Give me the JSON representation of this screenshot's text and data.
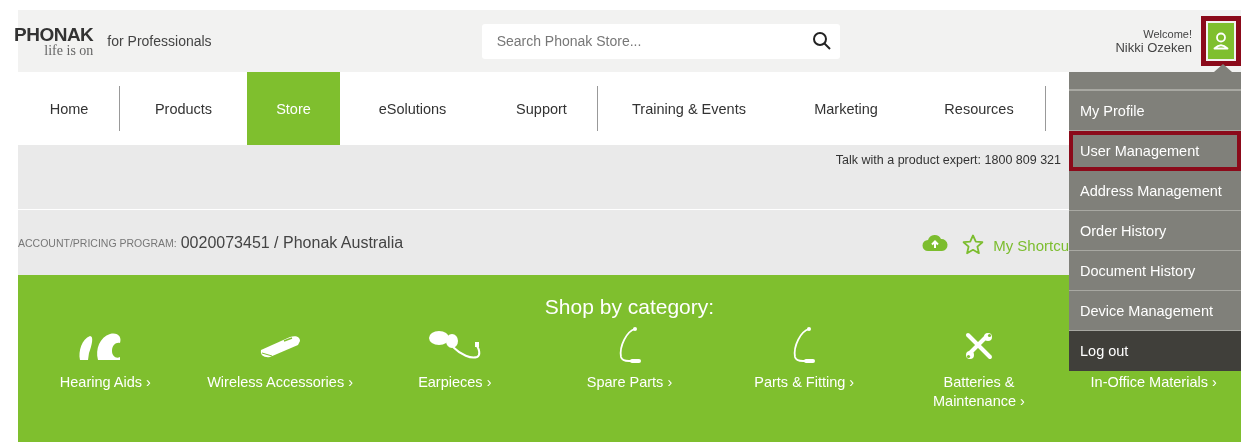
{
  "header": {
    "brand": "PHONAK",
    "tagline": "life is on",
    "subtitle": "for Professionals",
    "search": {
      "placeholder": "Search Phonak Store..."
    },
    "welcome": "Welcome!",
    "user_name": "Nikki Ozeken",
    "user_button": {
      "highlighted": true
    }
  },
  "nav": [
    {
      "label": "Home",
      "selected": false,
      "divider": true
    },
    {
      "label": "Products",
      "selected": false,
      "divider": false
    },
    {
      "label": "Store",
      "selected": true,
      "divider": false
    },
    {
      "label": "eSolutions",
      "selected": false,
      "divider": false
    },
    {
      "label": "Support",
      "selected": false,
      "divider": true
    },
    {
      "label": "Training & Events",
      "selected": false,
      "divider": false
    },
    {
      "label": "Marketing",
      "selected": false,
      "divider": false
    },
    {
      "label": "Resources",
      "selected": false,
      "divider": true
    }
  ],
  "contact": "Talk with a product expert: 1800 809 321",
  "account": {
    "label": "ACCOUNT/PRICING PROGRAM:",
    "value": "0020073451 / Phonak Australia",
    "shortcuts": "My Shortcu"
  },
  "category_section": {
    "title": "Shop by category:",
    "categories": [
      {
        "label": "Hearing Aids ›"
      },
      {
        "label": "Wireless Accessories ›"
      },
      {
        "label": "Earpieces ›"
      },
      {
        "label": "Spare Parts ›"
      },
      {
        "label": "Parts & Fitting ›"
      },
      {
        "label": "Batteries &",
        "label_2": "Maintenance ›"
      },
      {
        "label": "In-Office Materials ›"
      }
    ]
  },
  "user_menu": [
    {
      "label": "My Profile",
      "kind": "link",
      "highlighted": false
    },
    {
      "label": "User Management",
      "kind": "link",
      "highlighted": true
    },
    {
      "label": "Address Management",
      "kind": "link",
      "highlighted": false
    },
    {
      "label": "Order History",
      "kind": "link",
      "highlighted": false
    },
    {
      "label": "Document History",
      "kind": "link",
      "highlighted": false
    },
    {
      "label": "Device Management",
      "kind": "link",
      "highlighted": false
    },
    {
      "label": "Log out",
      "kind": "logout",
      "highlighted": false
    }
  ]
}
